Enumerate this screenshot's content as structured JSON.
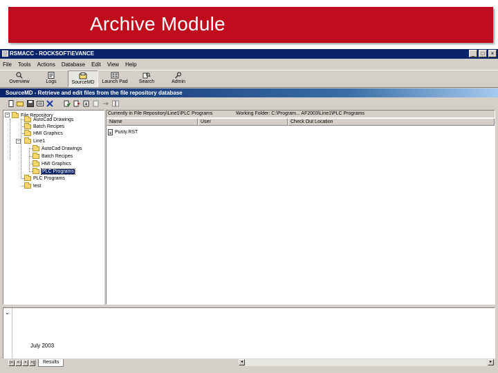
{
  "slide": {
    "title": "Archive Module",
    "footer_date": "July 2003",
    "banner_color": "#c00d1e"
  },
  "window": {
    "title": "RSMACC - ROCKSOFT\\EVANCE",
    "title_color": "#0a246a",
    "controls": [
      "_",
      "□",
      "×"
    ]
  },
  "menu": [
    "File",
    "Tools",
    "Actions",
    "Database",
    "Edit",
    "View",
    "Help"
  ],
  "toolbar": [
    {
      "label": "Overview",
      "icon": "overview-icon",
      "active": false
    },
    {
      "label": "Logs",
      "icon": "logs-icon",
      "active": false
    },
    {
      "label": "SourceMD",
      "icon": "sourcemd-icon",
      "active": true
    },
    {
      "label": "Launch Pad",
      "icon": "launch-pad-icon",
      "active": false
    },
    {
      "label": "Search",
      "icon": "search-icon",
      "active": false
    },
    {
      "label": "Admin",
      "icon": "admin-icon",
      "active": false
    }
  ],
  "infobar": "SourceMD - Retrieve and edit files from the file repository database",
  "subtoolbar_icons": [
    "new-icon",
    "open-folder-icon",
    "save-icon",
    "properties-icon",
    "delete-icon",
    "check-in-icon",
    "check-out-icon",
    "get-latest-icon",
    "undo-checkout-icon",
    "history-icon",
    "compare-icon"
  ],
  "tree": {
    "root": "File Repository",
    "children": [
      "AutoCad Drawings",
      "Batch Recipes",
      "HMI Graphics",
      "Line1",
      "AutoCad Drawings",
      "Batch Recipes",
      "HMI Graphics",
      "PLC Programs",
      "PLC Programs",
      "test"
    ],
    "selected": "PLC Programs"
  },
  "list": {
    "location": "Currently in File Repository\\Line1\\PLC Programs",
    "working_folder": "Working Folder: C:\\Program... AF2003\\Line1\\PLC Programs",
    "columns": [
      "Name",
      "User",
      "Check Out Location"
    ],
    "rows": [
      {
        "name": "Purity.RST",
        "user": "",
        "location": ""
      }
    ]
  },
  "results": {
    "tab_label": "Results",
    "nav": [
      "|<",
      "<",
      ">",
      ">|"
    ]
  }
}
